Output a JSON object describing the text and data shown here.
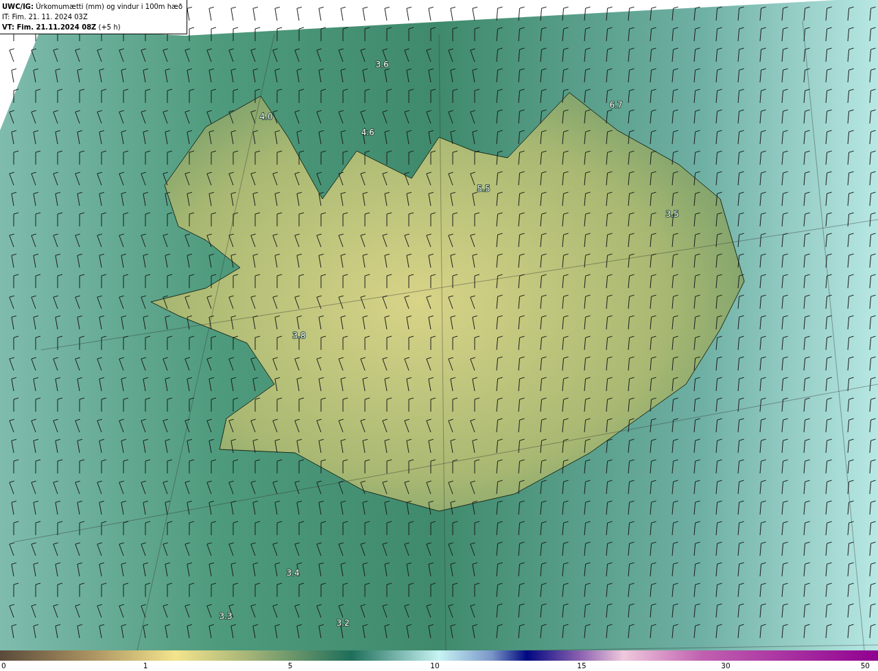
{
  "header": {
    "model": "UWC/IG:",
    "title": "Úrkomumætti (mm) og vindur i 100m hæð",
    "issue_time": "IT: Fim. 21. 11. 2024 03Z",
    "valid_label": "VT: Fim. 21.11.2024 08Z",
    "valid_offset": "(+5 h)"
  },
  "map_labels": [
    "3.6",
    "4.0",
    "4.6",
    "6.7",
    "5.5",
    "3.5",
    "3.8",
    "3.4",
    "3.3",
    "3.2"
  ],
  "colorbar": {
    "ticks": [
      "0",
      "1",
      "5",
      "10",
      "15",
      "30",
      "50"
    ]
  }
}
